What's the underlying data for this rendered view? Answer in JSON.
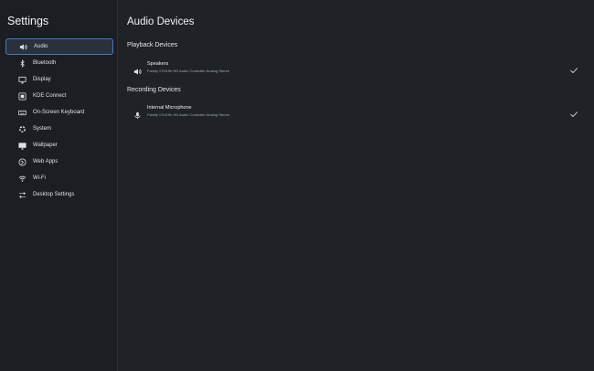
{
  "app": {
    "title": "Settings"
  },
  "sidebar": {
    "items": [
      {
        "label": "Audio",
        "icon": "speaker-icon",
        "active": true
      },
      {
        "label": "Bluetooth",
        "icon": "bluetooth-icon"
      },
      {
        "label": "Display",
        "icon": "display-icon"
      },
      {
        "label": "KDE Connect",
        "icon": "kde-connect-icon"
      },
      {
        "label": "On-Screen Keyboard",
        "icon": "keyboard-icon"
      },
      {
        "label": "System",
        "icon": "system-icon"
      },
      {
        "label": "Wallpaper",
        "icon": "wallpaper-icon"
      },
      {
        "label": "Web Apps",
        "icon": "globe-icon"
      },
      {
        "label": "Wi-Fi",
        "icon": "wifi-icon"
      },
      {
        "label": "Desktop Settings",
        "icon": "desktop-settings-icon"
      }
    ]
  },
  "main": {
    "title": "Audio Devices",
    "playback": {
      "heading": "Playback Devices",
      "devices": [
        {
          "name": "Speakers",
          "description": "Family 17h/19h HD Audio Controller Analog Stereo",
          "icon": "speaker-icon",
          "selected": true
        }
      ]
    },
    "recording": {
      "heading": "Recording Devices",
      "devices": [
        {
          "name": "Internal Microphone",
          "description": "Family 17h/19h HD Audio Controller Analog Stereo",
          "icon": "microphone-icon",
          "selected": true
        }
      ]
    }
  },
  "colors": {
    "background": "#1f2227",
    "sidebar": "#1b1e23",
    "active_border": "#4a76c6",
    "active_fill": "#2a313b"
  }
}
